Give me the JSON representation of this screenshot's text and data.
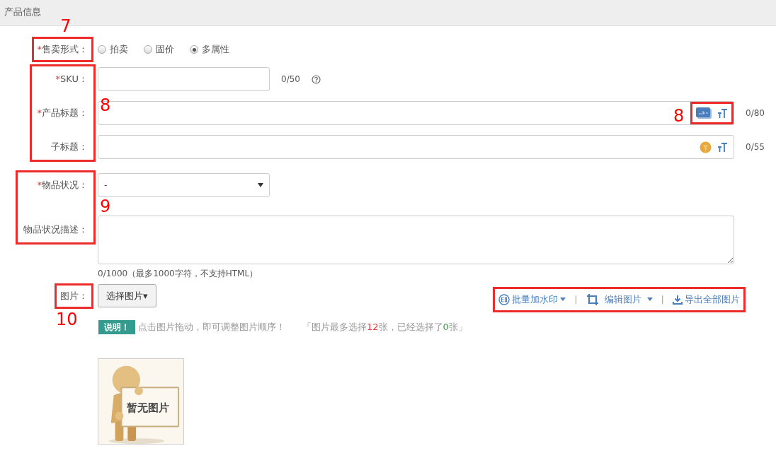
{
  "header": {
    "title": "产品信息"
  },
  "rows": [
    {
      "kind": "radio",
      "required_mark": "*",
      "label": "售卖形式：",
      "options": [
        {
          "label": "拍卖",
          "selected": false
        },
        {
          "label": "固价",
          "selected": false
        },
        {
          "label": "多属性",
          "selected": true
        }
      ]
    },
    {
      "kind": "short_input",
      "required_mark": "*",
      "label": "SKU：",
      "counter": "0/50",
      "help": true
    },
    {
      "kind": "long_input",
      "required_mark": "*",
      "label": "产品标题：",
      "counter": "0/80",
      "addon": {
        "kind": "spellcheck"
      }
    },
    {
      "kind": "long_input",
      "label": "子标题：",
      "counter": "0/55",
      "addon": {
        "kind": "coin"
      }
    },
    {
      "kind": "select",
      "required_mark": "*",
      "label": "物品状况：",
      "value": "-"
    },
    {
      "kind": "textarea",
      "label": "物品状况描述：",
      "counter": "0/1000（最多1000字符，不支持HTML）"
    }
  ],
  "images": {
    "label": "图片：",
    "button": "选择图片▾",
    "actions": [
      {
        "kind": "watermark",
        "label": "批量加水印",
        "dropdown": true
      },
      {
        "kind": "crop",
        "label": "编辑图片",
        "dropdown": true
      },
      {
        "kind": "download",
        "label": "导出全部图片",
        "dropdown": false
      }
    ],
    "separators": [
      "|",
      "|"
    ],
    "note_badge": "说明！",
    "note": "点击图片拖动，即可调整图片顺序！",
    "limit": [
      {
        "text": "「图片最多选择",
        "color": "#999999"
      },
      {
        "text": "12",
        "color": "#e4393c"
      },
      {
        "text": "张，已经选择了",
        "color": "#999999"
      },
      {
        "text": "0",
        "color": "#2e9a3c"
      },
      {
        "text": "张」",
        "color": "#999999"
      }
    ],
    "placeholder_caption": "暂无图片"
  },
  "annotations": [
    {
      "kind": "numbered",
      "label": "7"
    },
    {
      "kind": "numbered",
      "label": "8"
    },
    {
      "kind": "numbered",
      "label": "8"
    },
    {
      "kind": "numbered",
      "label": "9"
    },
    {
      "kind": "numbered",
      "label": "10"
    },
    {
      "kind": "box"
    }
  ]
}
